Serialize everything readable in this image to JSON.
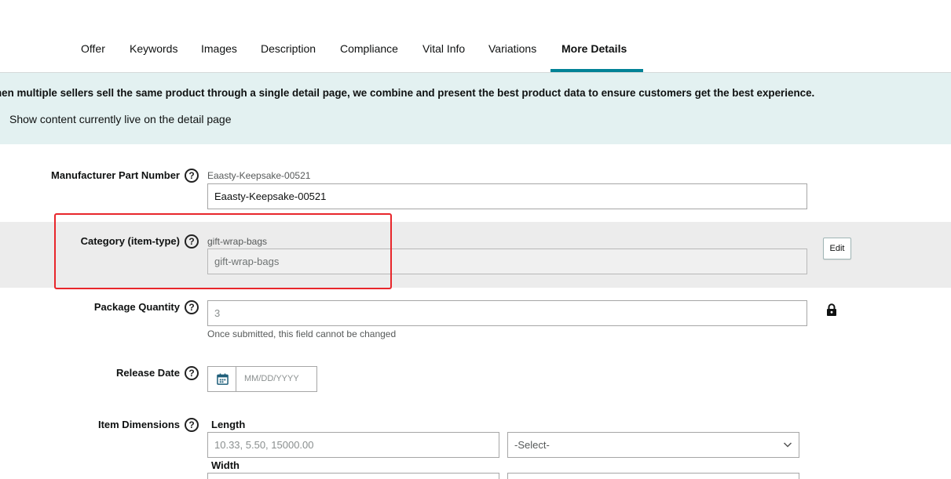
{
  "tabs": [
    {
      "label": "Offer",
      "active": false
    },
    {
      "label": "Keywords",
      "active": false
    },
    {
      "label": "Images",
      "active": false
    },
    {
      "label": "Description",
      "active": false
    },
    {
      "label": "Compliance",
      "active": false
    },
    {
      "label": "Vital Info",
      "active": false
    },
    {
      "label": "Variations",
      "active": false
    },
    {
      "label": "More Details",
      "active": true
    }
  ],
  "banner": {
    "text": "hen multiple sellers sell the same product through a single detail page, we combine and present the best product data to ensure customers get the best experience.",
    "link": "Show content currently live on the detail page"
  },
  "fields": {
    "manufacturer_part_number": {
      "label": "Manufacturer Part Number",
      "current": "Eaasty-Keepsake-00521",
      "value": "Eaasty-Keepsake-00521"
    },
    "category": {
      "label": "Category (item-type)",
      "current": "gift-wrap-bags",
      "value": "gift-wrap-bags",
      "edit_label": "Edit"
    },
    "package_quantity": {
      "label": "Package Quantity",
      "value": "3",
      "hint": "Once submitted, this field cannot be changed"
    },
    "release_date": {
      "label": "Release Date",
      "placeholder": "MM/DD/YYYY"
    },
    "item_dimensions": {
      "label": "Item Dimensions",
      "length_label": "Length",
      "length_placeholder": "10.33, 5.50, 15000.00",
      "length_unit": "-Select-",
      "width_label": "Width"
    }
  },
  "help_glyph": "?",
  "icons": {
    "help": "question-circle-icon",
    "lock": "lock-icon",
    "calendar": "calendar-icon",
    "chevron": "chevron-down-icon"
  },
  "colors": {
    "active_tab_underline": "#008296",
    "banner_bg": "#e3f1f1",
    "highlight_row_bg": "#ececec",
    "annotation_red": "#e8262b"
  }
}
